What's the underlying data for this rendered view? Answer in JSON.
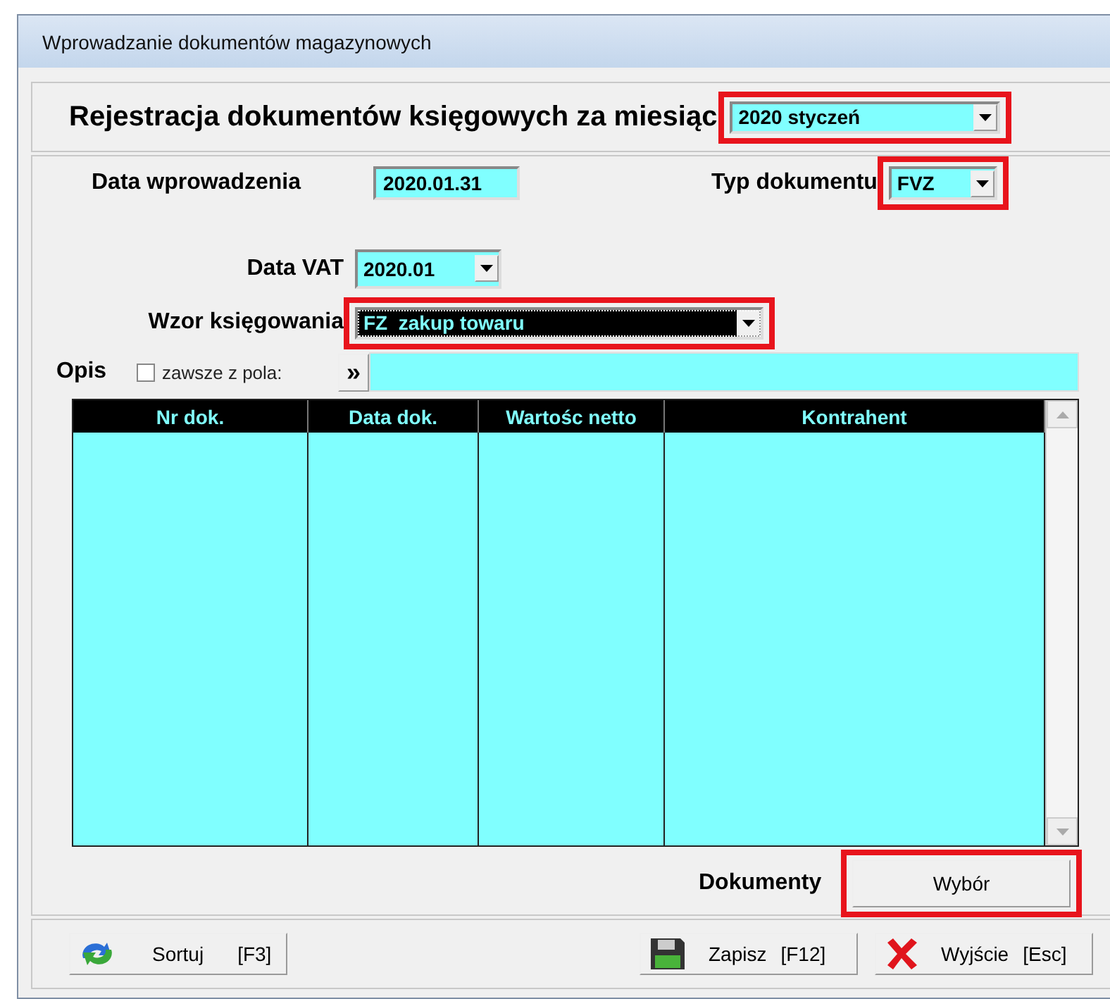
{
  "window": {
    "title": "Wprowadzanie dokumentów magazynowych"
  },
  "header": {
    "title": "Rejestracja dokumentów księgowych za miesiąc",
    "month": {
      "value": "2020 styczeń",
      "highlighted": true
    }
  },
  "entry_date": {
    "label": "Data wprowadzenia",
    "value": "2020.01.31"
  },
  "doc_type": {
    "label": "Typ dokumentu",
    "value": "FVZ",
    "highlighted": true
  },
  "vat_date": {
    "label": "Data VAT",
    "value": "2020.01",
    "highlighted": false
  },
  "template": {
    "label": "Wzor księgowania",
    "value": "FZ  zakup towaru",
    "highlighted": true
  },
  "description": {
    "label": "Opis",
    "checkbox": {
      "label": "zawsze z pola:",
      "checked": false
    },
    "button": "»"
  },
  "table": {
    "columns": [
      "Nr dok.",
      "Data dok.",
      "Wartośc netto",
      "Kontrahent"
    ]
  },
  "documents": {
    "label": "Dokumenty",
    "button": "Wybór",
    "highlighted": true
  },
  "footer": {
    "buttons": [
      {
        "kind": "sort",
        "label": "Sortuj",
        "key": "[F3]"
      },
      {
        "kind": "save",
        "label": "Zapisz",
        "key": "[F12]"
      },
      {
        "kind": "exit",
        "label": "Wyjście",
        "key": "[Esc]"
      }
    ]
  }
}
